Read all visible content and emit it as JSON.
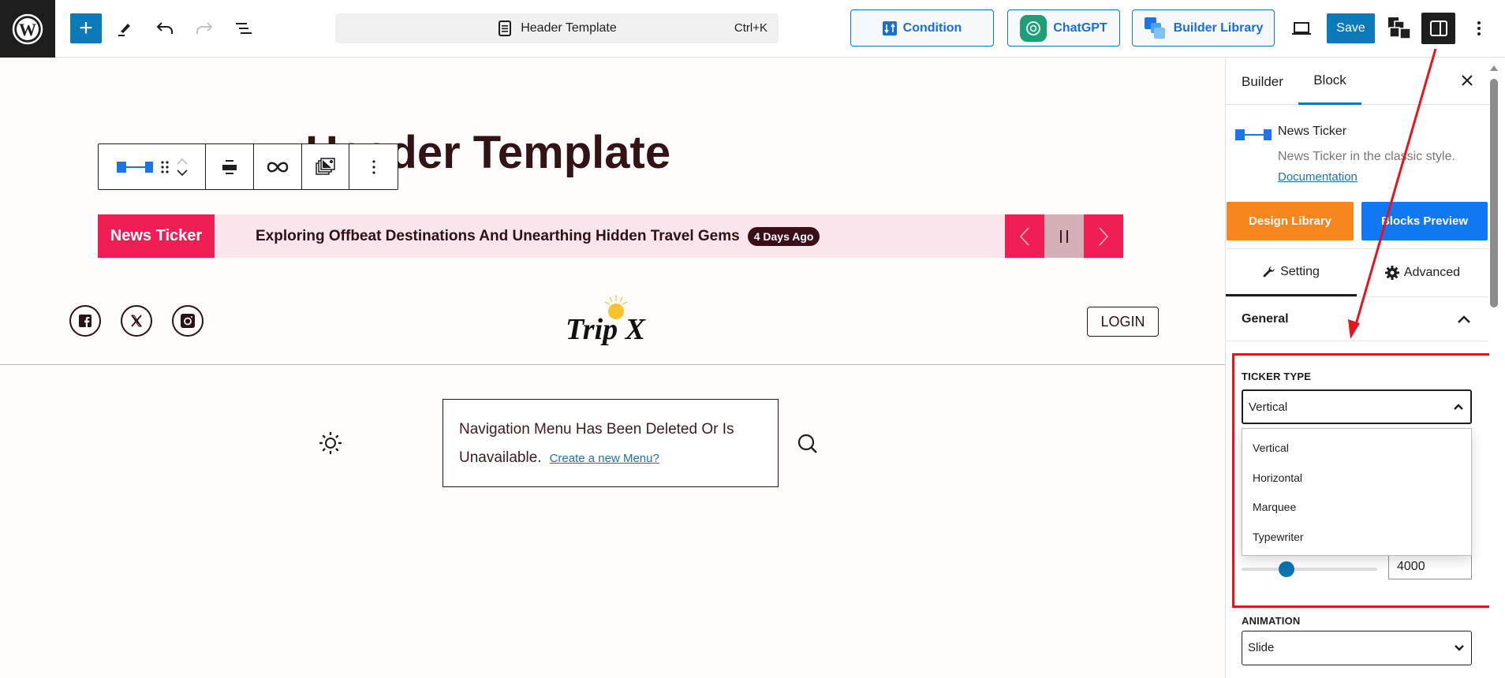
{
  "topbar": {
    "document_title": "Header Template",
    "shortcut": "Ctrl+K",
    "condition_label": "Condition",
    "chatgpt_label": "ChatGPT",
    "builder_library_label": "Builder Library",
    "save_label": "Save"
  },
  "canvas": {
    "heading": "Header Template",
    "ticker": {
      "label": "News Ticker",
      "headline": "Exploring Offbeat Destinations And Unearthing Hidden Travel Gems",
      "badge": "4 Days Ago",
      "prev_glyph": "‹",
      "pause_glyph": "I I",
      "next_glyph": "›"
    },
    "logo_text": "Trip X",
    "login_label": "LOGIN",
    "nav_message": "Navigation Menu Has Been Deleted Or Is Unavailable.",
    "nav_link": "Create a new Menu?"
  },
  "sidebar": {
    "tabs": [
      "Builder",
      "Block"
    ],
    "active_tab": "Block",
    "block": {
      "title": "News Ticker",
      "description": "News Ticker in the classic style.",
      "doc_link": "Documentation"
    },
    "design_library_label": "Design Library",
    "blocks_preview_label": "Blocks Preview",
    "setting_tabs": [
      "Setting",
      "Advanced"
    ],
    "active_setting_tab": "Setting",
    "section_title": "General",
    "ticker_type": {
      "label": "TICKER TYPE",
      "value": "Vertical",
      "options": [
        "Vertical",
        "Horizontal",
        "Marquee",
        "Typewriter"
      ]
    },
    "speed": {
      "value": "4000",
      "slider_fraction": 0.33
    },
    "animation": {
      "label": "ANIMATION",
      "value": "Slide"
    }
  },
  "colors": {
    "wp_blue": "#0a7bb8",
    "ticker_red": "#f01e55",
    "ticker_bg": "#fbe5ec",
    "annotation_red": "#e5141d",
    "design_orange": "#f7861f",
    "preview_blue": "#1078f3"
  }
}
